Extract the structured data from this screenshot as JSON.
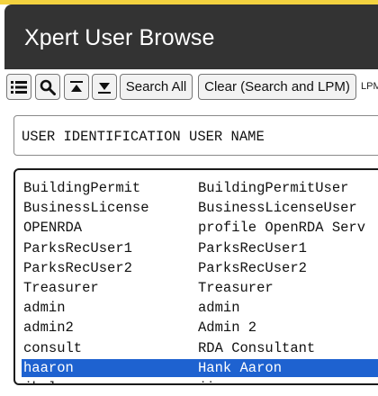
{
  "window": {
    "title": "Xpert User Browse"
  },
  "toolbar": {
    "search_all_label": "Search All",
    "clear_label": "Clear (Search and LPM)",
    "lpm_label": "LPM"
  },
  "header": {
    "columns": "USER IDENTIFICATION USER NAME"
  },
  "list": {
    "rows": [
      {
        "id": "BuildingPermit",
        "name": "BuildingPermitUser"
      },
      {
        "id": "BusinessLicense",
        "name": "BusinessLicenseUser"
      },
      {
        "id": "OPENRDA",
        "name": "profile OpenRDA Serv"
      },
      {
        "id": "ParksRecUser1",
        "name": "ParksRecUser1"
      },
      {
        "id": "ParksRecUser2",
        "name": "ParksRecUser2"
      },
      {
        "id": "Treasurer",
        "name": "Treasurer"
      },
      {
        "id": "admin",
        "name": "admin"
      },
      {
        "id": "admin2",
        "name": "Admin 2"
      },
      {
        "id": "consult",
        "name": "RDA Consultant"
      },
      {
        "id": "haaron",
        "name": "Hank Aaron"
      },
      {
        "id": "jkalcoso",
        "name": "jim"
      }
    ],
    "selected_index": 9
  },
  "colors": {
    "selection": "#1e62d0",
    "titlebar": "#333333",
    "accent_strip": "#f3d23f"
  },
  "icons": [
    "list-icon",
    "search-icon",
    "top-icon",
    "bottom-icon"
  ]
}
